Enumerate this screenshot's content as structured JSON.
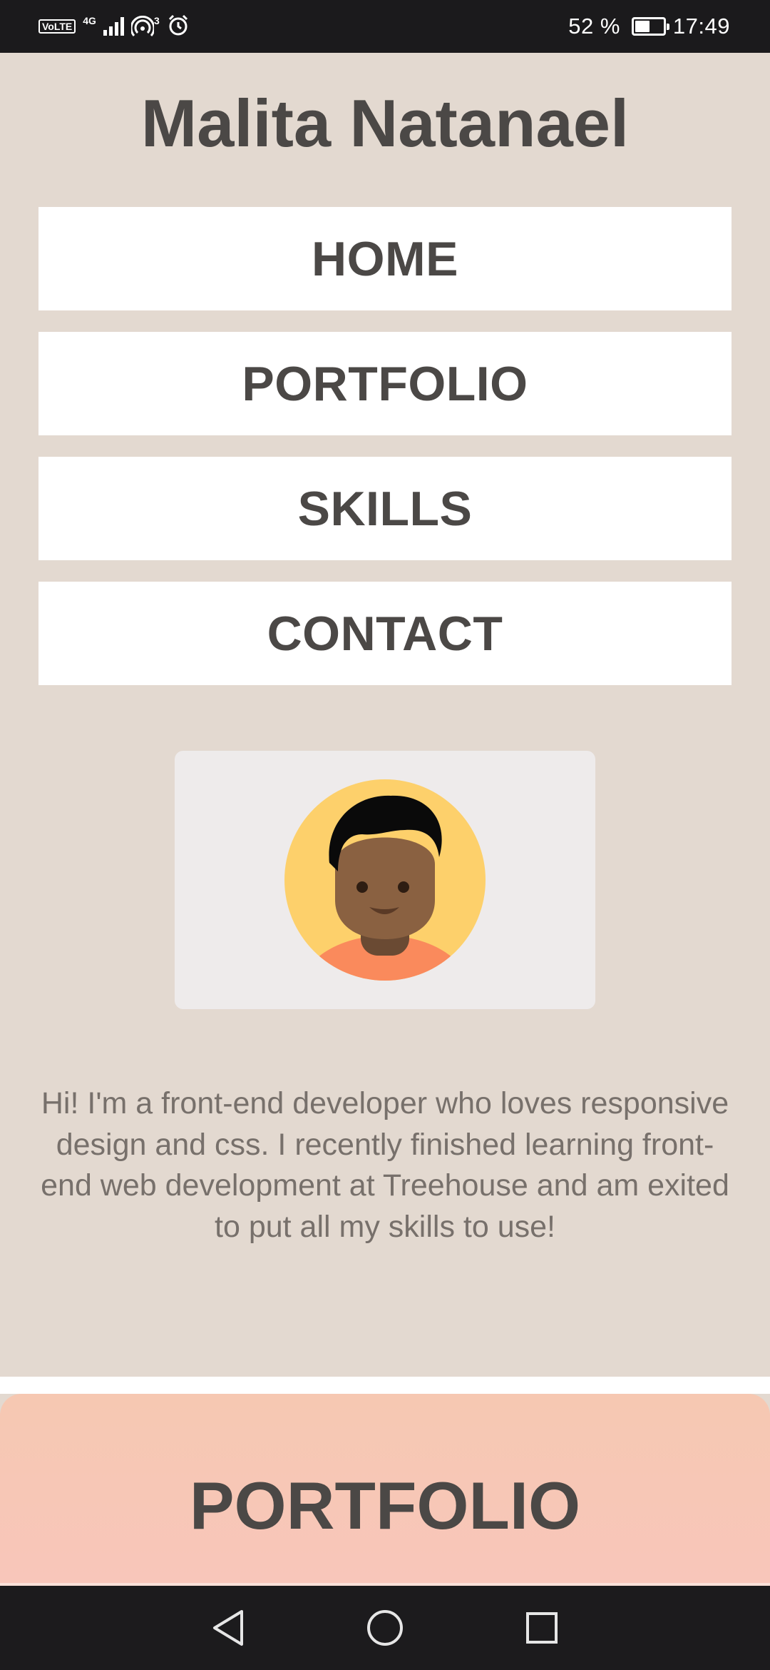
{
  "status_bar": {
    "volte": "VoLTE",
    "network": "4G",
    "hotspot_count": "3",
    "battery": "52 %",
    "battery_level": 0.52,
    "time": "17:49"
  },
  "header": {
    "title": "Malita Natanael"
  },
  "nav": {
    "items": [
      {
        "label": "HOME"
      },
      {
        "label": "PORTFOLIO"
      },
      {
        "label": "SKILLS"
      },
      {
        "label": "CONTACT"
      }
    ]
  },
  "profile": {
    "avatar_icon": "person-avatar-icon",
    "bio": "Hi! I'm a front-end developer who loves responsive design and css. I recently finished learning front-end web development at Treehouse and am exited to put all my skills to use!"
  },
  "portfolio": {
    "heading": "PORTFOLIO"
  },
  "colors": {
    "page_bg": "#e3d9d0",
    "text": "#4b4846",
    "bio_text": "#77706b",
    "nav_bg": "#ffffff",
    "portfolio_bg": "#f6c8b2",
    "avatar_circle": "#fdd06b",
    "avatar_shirt": "#fa8a5c",
    "avatar_skin": "#8a6141"
  },
  "android_nav": {
    "back_icon": "back-triangle-icon",
    "home_icon": "home-circle-icon",
    "recents_icon": "recents-square-icon"
  }
}
